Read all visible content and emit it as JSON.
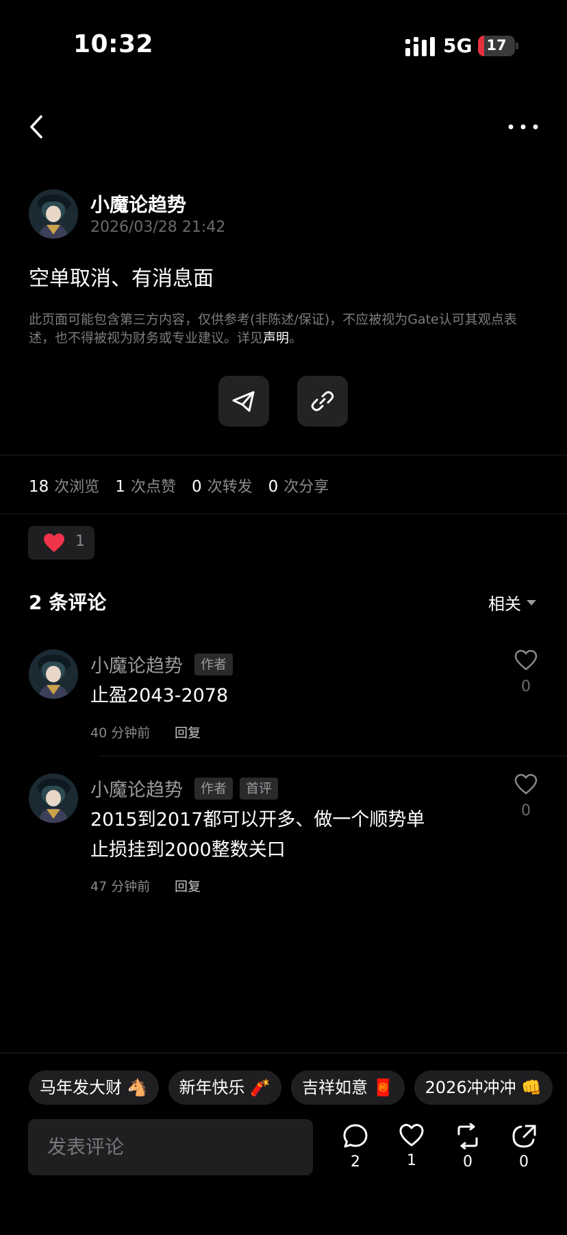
{
  "status_bar": {
    "time": "10:32",
    "network": "5G",
    "battery": "17",
    "battery_level_percent": 17,
    "battery_color": "#e5323f"
  },
  "nav": {
    "back_icon": "chevron-left-icon",
    "more_icon": "more-horizontal-icon"
  },
  "post": {
    "author": "小魔论趋势",
    "timestamp": "2026/03/28 21:42",
    "content": "空单取消、有消息面",
    "disclaimer_text": "此页面可能包含第三方内容，仅供参考(非陈述/保证)，不应被视为Gate认可其观点表述，也不得被视为财务或专业建议。详见",
    "disclaimer_link": "声明",
    "disclaimer_end": "。"
  },
  "share_actions": [
    {
      "icon": "telegram-icon"
    },
    {
      "icon": "link-icon"
    }
  ],
  "stats": {
    "views_count": "18",
    "views_label": "次浏览",
    "likes_count": "1",
    "likes_label": "次点赞",
    "reposts_count": "0",
    "reposts_label": "次转发",
    "shares_count": "0",
    "shares_label": "次分享"
  },
  "reaction": {
    "icon": "heart-filled-icon",
    "count": "1",
    "color": "#f0344a"
  },
  "comments_section": {
    "header": "2 条评论",
    "sort_label": "相关"
  },
  "comments": [
    {
      "author": "小魔论趋势",
      "badges": [
        "作者"
      ],
      "lines": [
        "止盈2043-2078"
      ],
      "time": "40 分钟前",
      "reply_label": "回复",
      "like_count": "0"
    },
    {
      "author": "小魔论趋势",
      "badges": [
        "作者",
        "首评"
      ],
      "lines": [
        "2015到2017都可以开多、做一个顺势单",
        "止损挂到2000整数关口"
      ],
      "time": "47 分钟前",
      "reply_label": "回复",
      "like_count": "0"
    }
  ],
  "quick_tags": [
    {
      "label": "马年发大财",
      "emoji": "🐴"
    },
    {
      "label": "新年快乐",
      "emoji": "🧨"
    },
    {
      "label": "吉祥如意",
      "emoji": "🧧"
    },
    {
      "label": "2026冲冲冲",
      "emoji": "👊"
    }
  ],
  "bottom_bar": {
    "input_placeholder": "发表评论",
    "actions": [
      {
        "icon": "comment-icon",
        "count": "2"
      },
      {
        "icon": "heart-outline-icon",
        "count": "1"
      },
      {
        "icon": "repost-icon",
        "count": "0"
      },
      {
        "icon": "share-icon",
        "count": "0"
      }
    ]
  }
}
